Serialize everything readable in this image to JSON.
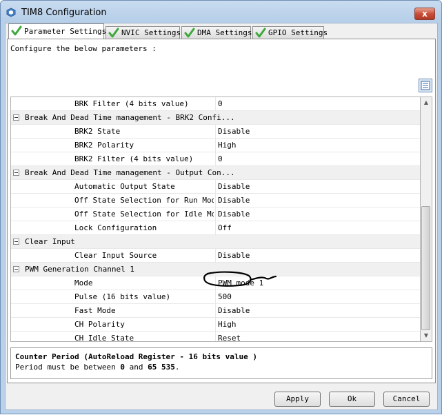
{
  "window": {
    "title": "TIM8 Configuration",
    "close_label": "x"
  },
  "tabs": [
    {
      "label": "Parameter Settings",
      "active": true
    },
    {
      "label": "NVIC Settings",
      "active": false
    },
    {
      "label": "DMA Settings",
      "active": false
    },
    {
      "label": "GPIO Settings",
      "active": false
    }
  ],
  "instruction": "Configure the below parameters :",
  "params": {
    "rows": [
      {
        "kind": "param",
        "name": "BRK Filter (4 bits value)",
        "value": "0"
      },
      {
        "kind": "group",
        "name": "Break And Dead Time management - BRK2 Confi..."
      },
      {
        "kind": "param",
        "name": "BRK2 State",
        "value": "Disable"
      },
      {
        "kind": "param",
        "name": "BRK2 Polarity",
        "value": "High"
      },
      {
        "kind": "param",
        "name": "BRK2 Filter (4 bits value)",
        "value": "0"
      },
      {
        "kind": "group",
        "name": "Break And Dead Time management - Output Con..."
      },
      {
        "kind": "param",
        "name": "Automatic Output State",
        "value": "Disable"
      },
      {
        "kind": "param",
        "name": "Off State Selection for Run Mod...",
        "value": "Disable"
      },
      {
        "kind": "param",
        "name": "Off State Selection for Idle Mo...",
        "value": "Disable"
      },
      {
        "kind": "param",
        "name": "Lock Configuration",
        "value": "Off"
      },
      {
        "kind": "group",
        "name": "Clear Input"
      },
      {
        "kind": "param",
        "name": "Clear Input Source",
        "value": "Disable"
      },
      {
        "kind": "group",
        "name": "PWM Generation Channel 1"
      },
      {
        "kind": "param",
        "name": "Mode",
        "value": "PWM mode 1"
      },
      {
        "kind": "param",
        "name": "Pulse (16 bits value)",
        "value": "500"
      },
      {
        "kind": "param",
        "name": "Fast Mode",
        "value": "Disable"
      },
      {
        "kind": "param",
        "name": "CH Polarity",
        "value": "High"
      },
      {
        "kind": "param",
        "name": "CH Idle State",
        "value": "Reset"
      }
    ]
  },
  "description": {
    "title": "Counter Period (AutoReload Register - 16 bits value )",
    "text_prefix": "Period must be between ",
    "min": "0",
    "text_mid": " and ",
    "max": "65 535",
    "text_suffix": "."
  },
  "buttons": {
    "apply": "Apply",
    "ok": "Ok",
    "cancel": "Cancel"
  },
  "colors": {
    "check_green": "#3ea83a",
    "window_frame": "#b9d1ea"
  },
  "icons": {
    "tab": "check-icon",
    "app": "cube-icon",
    "view": "list-view-icon"
  }
}
